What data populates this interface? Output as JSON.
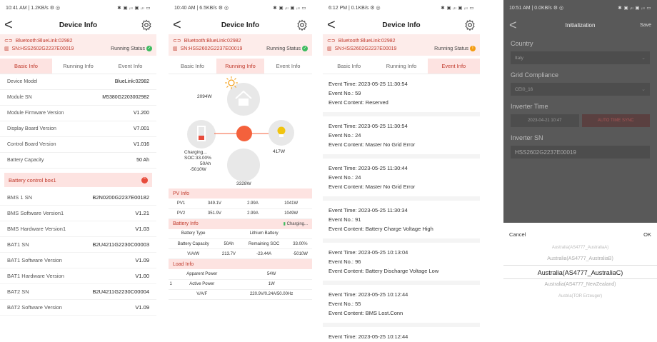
{
  "p1": {
    "status_left": "10:41 AM | 1.2KB/s ⚙ ◎",
    "status_right": "✱ ▣ ᵢₗₗ ▣ ᵢₗₗ ▭",
    "title": "Device Info",
    "bt_name": "Bluetooth:BlueLink:02982",
    "sn": "SN:HSS2602G2237E00019",
    "running_status": "Running Status",
    "tabs": [
      "Basic Info",
      "Running Info",
      "Event Info"
    ],
    "rows": [
      {
        "k": "Device Model",
        "v": "BlueLink:02982"
      },
      {
        "k": "Module SN",
        "v": "M5380G2203002982"
      },
      {
        "k": "Module Firmware Version",
        "v": "V1.200"
      },
      {
        "k": "Display Board Version",
        "v": "V7.001"
      },
      {
        "k": "Control Board Version",
        "v": "V1.016"
      },
      {
        "k": "Battery Capacity",
        "v": "50 Ah"
      }
    ],
    "section": "Battery control box1",
    "rows2": [
      {
        "k": "BMS 1 SN",
        "v": "B2N0200G2237E00182"
      },
      {
        "k": "BMS Software Version1",
        "v": "V1.21"
      },
      {
        "k": "BMS Hardware Version1",
        "v": "V1.03"
      },
      {
        "k": "BAT1 SN",
        "v": "B2U4211G2230C00003"
      },
      {
        "k": "BAT1 Software Version",
        "v": "V1.09"
      },
      {
        "k": "BAT1 Hardware Version",
        "v": "V1.00"
      },
      {
        "k": "BAT2 SN",
        "v": "B2U4211G2230C00004"
      },
      {
        "k": "BAT2 Software Version",
        "v": "V1.09"
      }
    ]
  },
  "p2": {
    "status_left": "10:40 AM | 6.5KB/s ⚙ ◎",
    "status_right": "✱ ▣ ᵢₗₗ ▣ ᵢₗₗ ▭",
    "title": "Device Info",
    "bt_name": "Bluetooth:BlueLink:02982",
    "sn": "SN:HSS2602G2237E00019",
    "running_status": "Running Status",
    "tabs": [
      "Basic Info",
      "Running Info",
      "Event Info"
    ],
    "load_w": "2094W",
    "charging": "Charging...",
    "soc": "SOC:33.00%",
    "cap": "50Ah",
    "batt_w": "-5010W",
    "grid_w": "417W",
    "pv_w": "3328W",
    "pv_info": "PV Info",
    "pv_rows": [
      [
        "PV1",
        "349.1V",
        "2.99A",
        "1041W"
      ],
      [
        "PV2",
        "351.9V",
        "2.99A",
        "1049W"
      ]
    ],
    "battery_info": "Battery Info",
    "battery_charging": "Charging...",
    "bat_rows": [
      [
        "Battery Type",
        "",
        "Lithium Battery",
        ""
      ],
      [
        "Battery Capacity",
        "50Ah",
        "Remaining SOC",
        "33.00%"
      ],
      [
        "V/A/W",
        "213.7V",
        "-23.44A",
        "-5010W"
      ]
    ],
    "load_info": "Load Info",
    "load_rows": [
      [
        "",
        "Apparent Power",
        "54W"
      ],
      [
        "1",
        "Active Power",
        "1W"
      ],
      [
        "",
        "V/A/F",
        "220.9V/0.24A/50.00Hz"
      ]
    ]
  },
  "p3": {
    "status_left": "6:12 PM | 0.1KB/s ⚙ ◎",
    "status_right": "✱ ▣ ᵢₗₗ ▣ ᵢₗₗ ▭",
    "title": "Device Info",
    "bt_name": "Bluetooth:BlueLink:02982",
    "sn": "SN:HSS2602G2237E00019",
    "running_status": "Running Status",
    "tabs": [
      "Basic Info",
      "Running Info",
      "Event Info"
    ],
    "events": [
      {
        "time": "Event Time:  2023-05-25 11:30:54",
        "no": "Event No.:  59",
        "content": "Event Content:  Reserved"
      },
      {
        "time": "Event Time:  2023-05-25 11:30:54",
        "no": "Event No.:  24",
        "content": "Event Content:  Master No Grid Error"
      },
      {
        "time": "Event Time:  2023-05-25 11:30:44",
        "no": "Event No.:  24",
        "content": "Event Content:  Master No Grid Error"
      },
      {
        "time": "Event Time:  2023-05-25 11:30:34",
        "no": "Event No.:  91",
        "content": "Event Content:  Battery Charge Voltage High"
      },
      {
        "time": "Event Time:  2023-05-25 10:13:04",
        "no": "Event No.:  96",
        "content": "Event Content:  Battery Discharge Voltage Low"
      },
      {
        "time": "Event Time:  2023-05-25 10:12:44",
        "no": "Event No.:  55",
        "content": "Event Content:  BMS Lost.Conn"
      },
      {
        "time": "Event Time:  2023-05-25 10:12:44",
        "no": "",
        "content": ""
      }
    ]
  },
  "p4": {
    "status_left": "10:51 AM | 0.0KB/s ⚙ ◎",
    "status_right": "✱ ▣ ᵢₗₗ ▣ ᵢₗₗ ▭",
    "title": "Initialization",
    "save": "Save",
    "country_label": "Country",
    "country_value": "Italy",
    "grid_label": "Grid Compliance",
    "grid_value": "CEI0_16",
    "time_label": "Inverter Time",
    "time_value": "2023-04-21 10:47",
    "sync_button": "AUTO TIME SYNC",
    "sn_label": "Inverter SN",
    "sn_value": "HSS2602G2237E00019",
    "cancel": "Cancel",
    "ok": "OK",
    "picker": [
      "Australia(AS4777_AustraliaA)",
      "Australia(AS4777_AustraliaB)",
      "Australia(AS4777_AustraliaC)",
      "Australia(AS4777_NewZealand)",
      "Austria(TOR Erzeuger)"
    ]
  }
}
